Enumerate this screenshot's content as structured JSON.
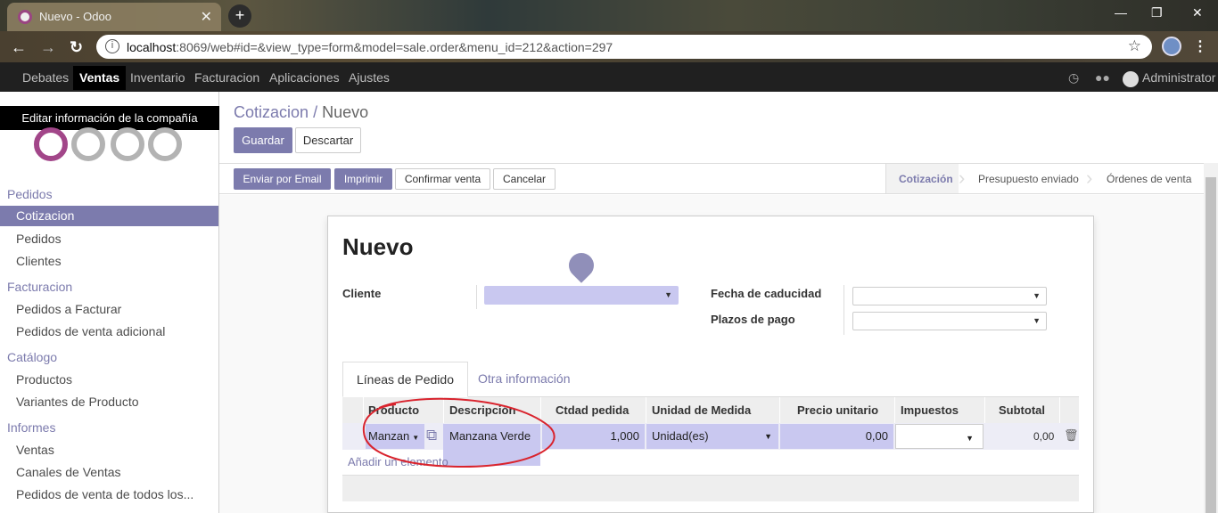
{
  "browser": {
    "tab_title": "Nuevo - Odoo",
    "url_host": "localhost",
    "url_rest": ":8069/web#id=&view_type=form&model=sale.order&menu_id=212&action=297"
  },
  "topnav": {
    "items": [
      "Debates",
      "Ventas",
      "Inventario",
      "Facturacion",
      "Aplicaciones",
      "Ajustes"
    ],
    "user": "Administrator"
  },
  "sidebar": {
    "company_tooltip": "Editar información de la compañía",
    "sections": [
      {
        "title": "Pedidos",
        "items": [
          "Cotizacion",
          "Pedidos",
          "Clientes"
        ]
      },
      {
        "title": "Facturacion",
        "items": [
          "Pedidos a Facturar",
          "Pedidos de venta adicional"
        ]
      },
      {
        "title": "Catálogo",
        "items": [
          "Productos",
          "Variantes de Producto"
        ]
      },
      {
        "title": "Informes",
        "items": [
          "Ventas",
          "Canales de Ventas",
          "Pedidos de venta de todos los..."
        ]
      }
    ]
  },
  "breadcrumb": {
    "parent": "Cotizacion",
    "sep": "/",
    "current": "Nuevo"
  },
  "buttons": {
    "save": "Guardar",
    "discard": "Descartar",
    "email": "Enviar por Email",
    "print": "Imprimir",
    "confirm": "Confirmar venta",
    "cancel": "Cancelar"
  },
  "stages": [
    "Cotización",
    "Presupuesto enviado",
    "Órdenes de venta"
  ],
  "form": {
    "title": "Nuevo",
    "customer_label": "Cliente",
    "expiry_label": "Fecha de caducidad",
    "payment_terms_label": "Plazos de pago"
  },
  "tabs": [
    "Líneas de Pedido",
    "Otra información"
  ],
  "table": {
    "headers": [
      "Producto",
      "Descripción",
      "Ctdad pedida",
      "Unidad de Medida",
      "Precio unitario",
      "Impuestos",
      "Subtotal"
    ],
    "row": {
      "product": "Manzan",
      "description": "Manzana Verde",
      "qty": "1,000",
      "uom": "Unidad(es)",
      "price": "0,00",
      "subtotal": "0,00"
    },
    "add_line": "Añadir un elemento"
  }
}
